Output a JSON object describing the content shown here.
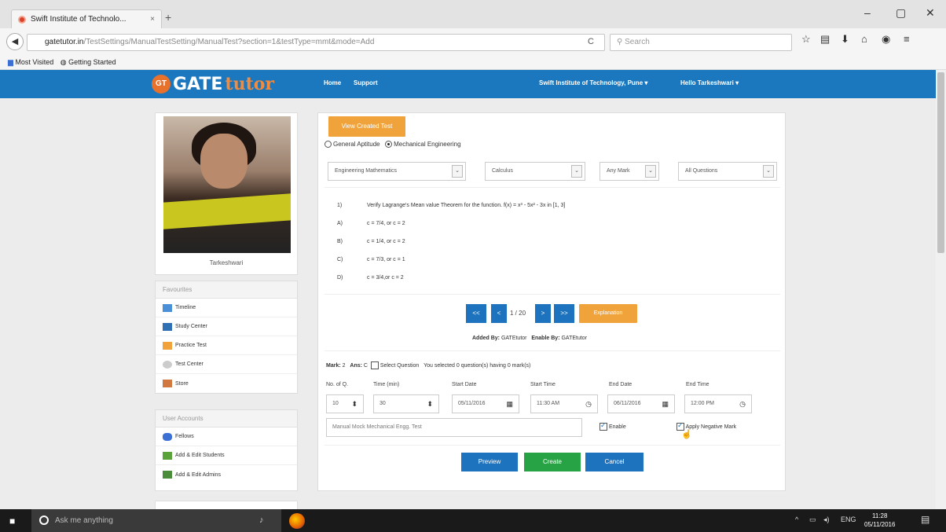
{
  "browser": {
    "tab_title": "Swift Institute of Technolo...",
    "tab_close": "×",
    "new_tab": "+",
    "url_domain": "gatetutor.in",
    "url_path": "/TestSettings/ManualTestSetting/ManualTest?section=1&testType=mmt&mode=Add",
    "search_placeholder": "Search",
    "bookmarks": [
      "Most Visited",
      "Getting Started"
    ]
  },
  "site": {
    "logo_badge": "GT",
    "logo_gate": "GATE",
    "logo_tutor": "tutor",
    "nav": [
      "Home",
      "Support"
    ],
    "institute": "Swift Institute of Technology, Pune ▾",
    "greeting": "Hello Tarkeshwari ▾"
  },
  "profile": {
    "name": "Tarkeshwari"
  },
  "favourites": {
    "heading": "Favourites",
    "items": [
      "Timeline",
      "Study Center",
      "Practice Test",
      "Test Center",
      "Store"
    ]
  },
  "user_accounts": {
    "heading": "User Accounts",
    "items": [
      "Fellows",
      "Add & Edit Students",
      "Add & Edit Admins"
    ]
  },
  "main": {
    "view_created_test": "View Created Test",
    "radio_general": "General Aptitude",
    "radio_mechanical": "Mechanical Engineering",
    "selects": {
      "subject": "Engineering Mathematics",
      "topic": "Calculus",
      "mark": "Any Mark",
      "questions": "All Questions"
    },
    "question": {
      "number": "1)",
      "text": "Verify Lagrange's Mean value Theorem for the function. f(x) = x³ - 5x² - 3x in [1, 3]",
      "options": [
        {
          "key": "A)",
          "value": "c = 7/4, or c = 2"
        },
        {
          "key": "B)",
          "value": "c = 1/4, or c = 2"
        },
        {
          "key": "C)",
          "value": "c = 7/3, or c = 1"
        },
        {
          "key": "D)",
          "value": "c = 3/4,or c = 2"
        }
      ]
    },
    "pager": {
      "first": "<<",
      "prev": "<",
      "page": "1 / 20",
      "next": ">",
      "last": ">>",
      "explanation": "Explanation"
    },
    "added_by_label": "Added By:",
    "added_by": "GATEtutor",
    "enable_by_label": "Enable By:",
    "enable_by": "GATEtutor",
    "mark_label": "Mark:",
    "mark_value": "2",
    "ans_label": "Ans:",
    "ans_value": "C",
    "select_question": "Select Question",
    "selection_info": "You selected 0 question(s) having 0 mark(s)",
    "fields": {
      "no_of_q_label": "No. of Q.",
      "no_of_q": "10",
      "time_label": "Time (min)",
      "time": "30",
      "start_date_label": "Start Date",
      "start_date": "05/11/2016",
      "start_time_label": "Start Time",
      "start_time": "11:30 AM",
      "end_date_label": "End Date",
      "end_date": "06/11/2016",
      "end_time_label": "End Time",
      "end_time": "12:00 PM"
    },
    "test_name": "Manual Mock Mechanical Engg. Test",
    "enable_label": "Enable",
    "negative_label": "Apply Negative Mark",
    "buttons": {
      "preview": "Preview",
      "create": "Create",
      "cancel": "Cancel"
    }
  },
  "taskbar": {
    "search": "Ask me anything",
    "lang": "ENG",
    "time": "11:28",
    "date": "05/11/2016"
  }
}
